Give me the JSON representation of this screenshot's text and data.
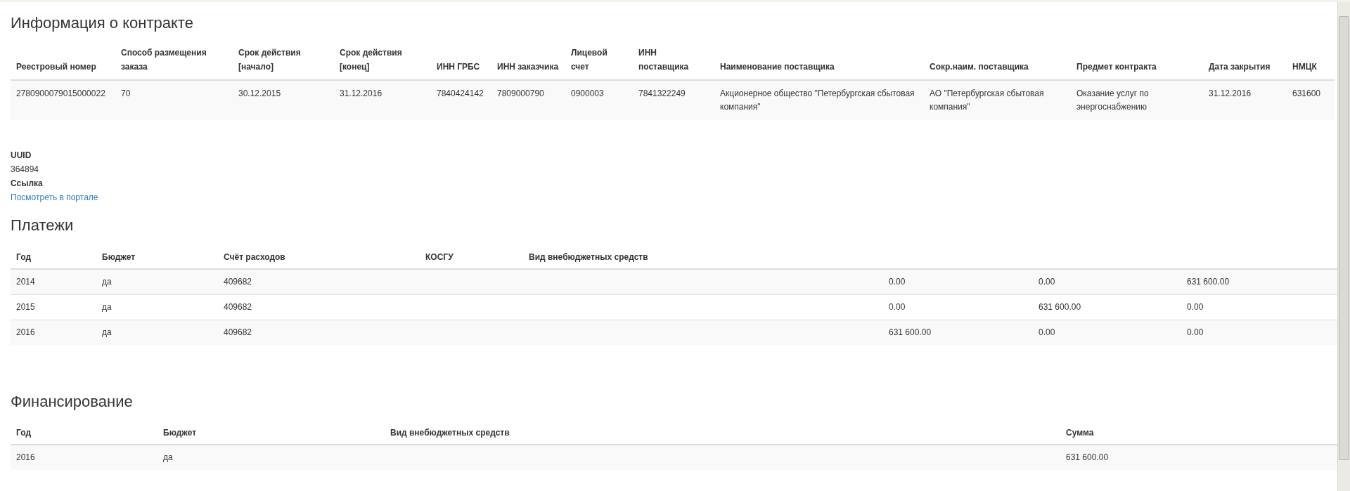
{
  "contract": {
    "title": "Информация о контракте",
    "columns": [
      "Реестровый номер",
      "Способ размещения заказа",
      "Срок действия [начало]",
      "Срок действия [конец]",
      "ИНН ГРБС",
      "ИНН заказчика",
      "Лицевой счет",
      "ИНН поставщика",
      "Наименование поставщика",
      "Сокр.наим. поставщика",
      "Предмет контракта",
      "Дата закрытия",
      "НМЦК"
    ],
    "rows": [
      [
        "2780900079015000022",
        "70",
        "30.12.2015",
        "31.12.2016",
        "7840424142",
        "7809000790",
        "0900003",
        "7841322249",
        "Акционерное общество \"Петербургская сбытовая компания\"",
        "АО \"Петербургская сбытовая компания\"",
        "Оказание услуг по энергоснабжению",
        "31.12.2016",
        "631600"
      ]
    ]
  },
  "details": [
    {
      "label": "UUID",
      "value": "364894",
      "kind": "text"
    },
    {
      "label": "Ссылка",
      "value": "Посмотреть в портале",
      "kind": "link"
    }
  ],
  "payments": {
    "title": "Платежи",
    "columns": [
      "Год",
      "Бюджет",
      "Счёт расходов",
      "КОСГУ",
      "Вид внебюджетных средств"
    ],
    "rows": [
      {
        "year": "2014",
        "budget": "да",
        "account": "409682",
        "column_6": "0.00",
        "column_7": "0.00",
        "column_8": "631 600.00"
      },
      {
        "year": "2015",
        "budget": "да",
        "account": "409682",
        "column_6": "0.00",
        "column_7": "631 600.00",
        "column_8": "0.00"
      },
      {
        "year": "2016",
        "budget": "да",
        "account": "409682",
        "column_6": "631 600.00",
        "column_7": "0.00",
        "column_8": "0.00"
      }
    ]
  },
  "financing": {
    "title": "Финансирование",
    "columns": [
      "Год",
      "Бюджет",
      "Вид внебюджетных средств",
      "Сумма"
    ],
    "rows": [
      {
        "year": "2016",
        "budget": "да",
        "amount": "631 600.00"
      }
    ]
  }
}
